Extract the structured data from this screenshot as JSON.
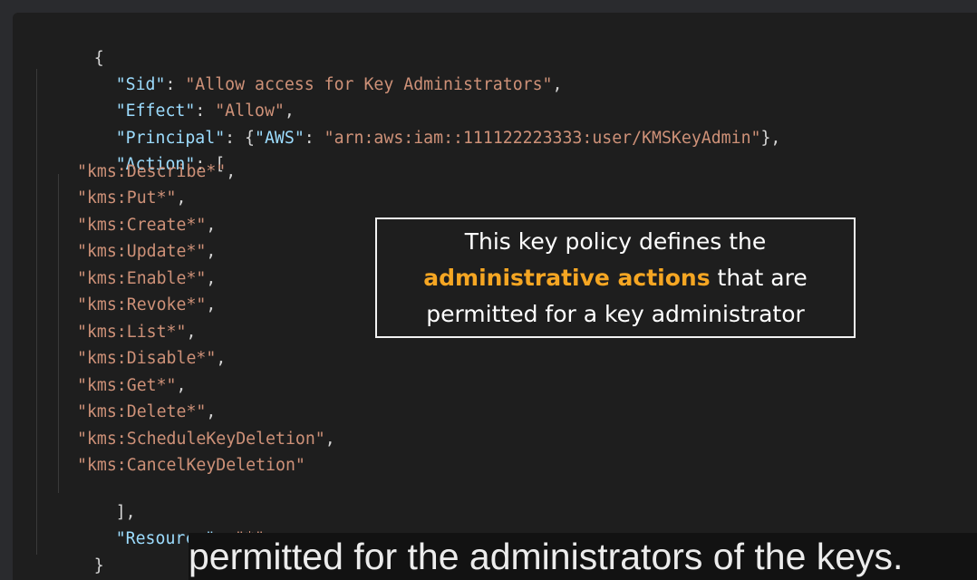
{
  "code": {
    "open_brace": "{",
    "sid_key": "\"Sid\"",
    "sid_value": "\"Allow access for Key Administrators\"",
    "effect_key": "\"Effect\"",
    "effect_value": "\"Allow\"",
    "principal_key": "\"Principal\"",
    "principal_aws_key": "\"AWS\"",
    "principal_aws_value": "\"arn:aws:iam::111122223333:user/KMSKeyAdmin\"",
    "action_key": "\"Action\"",
    "actions": [
      "\"kms:Describe*\"",
      "\"kms:Put*\"",
      "\"kms:Create*\"",
      "\"kms:Update*\"",
      "\"kms:Enable*\"",
      "\"kms:Revoke*\"",
      "\"kms:List*\"",
      "\"kms:Disable*\"",
      "\"kms:Get*\"",
      "\"kms:Delete*\"",
      "\"kms:ScheduleKeyDeletion\"",
      "\"kms:CancelKeyDeletion\""
    ],
    "action_close": "],",
    "resource_key": "\"Resource\"",
    "resource_value": "\"*\"",
    "close_brace": "}"
  },
  "callout": {
    "line1": "This key policy defines the",
    "highlight": "administrative actions",
    "line2_rest": " that are",
    "line3": "permitted for a key administrator",
    "highlight_color": "#f5a623"
  },
  "subtitle": {
    "text": "permitted for the administrators of the keys."
  }
}
